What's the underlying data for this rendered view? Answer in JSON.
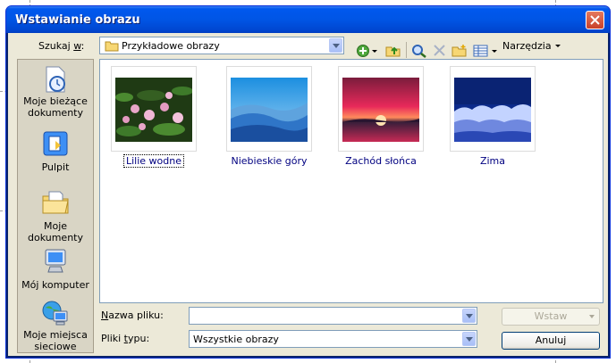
{
  "window": {
    "title": "Wstawianie obrazu"
  },
  "lookin": {
    "label_before": "Szukaj ",
    "label_key": "w",
    "label_after": ":",
    "value": "Przykładowe obrazy"
  },
  "toolbar": {
    "tools_label": "Narzędzia"
  },
  "places": [
    {
      "label": "Moje bieżące dokumenty",
      "icon": "recent-documents-icon"
    },
    {
      "label": "Pulpit",
      "icon": "desktop-icon"
    },
    {
      "label": "Moje dokumenty",
      "icon": "my-documents-icon"
    },
    {
      "label": "Mój komputer",
      "icon": "my-computer-icon"
    },
    {
      "label": "Moje miejsca sieciowe",
      "icon": "network-places-icon"
    }
  ],
  "files": [
    {
      "name": "Lilie wodne",
      "selected": true
    },
    {
      "name": "Niebieskie góry",
      "selected": false
    },
    {
      "name": "Zachód słońca",
      "selected": false
    },
    {
      "name": "Zima",
      "selected": false
    }
  ],
  "filename": {
    "label_key": "N",
    "label_rest": "azwa pliku:",
    "value": ""
  },
  "filetype": {
    "label_before": "Pliki ",
    "label_key": "t",
    "label_after": "ypu:",
    "value": "Wszystkie obrazy"
  },
  "buttons": {
    "insert": "Wstaw",
    "cancel": "Anuluj"
  },
  "colors": {
    "titlebar": "#0055e5",
    "dialog": "#ece9d8",
    "link_text": "#000080"
  }
}
